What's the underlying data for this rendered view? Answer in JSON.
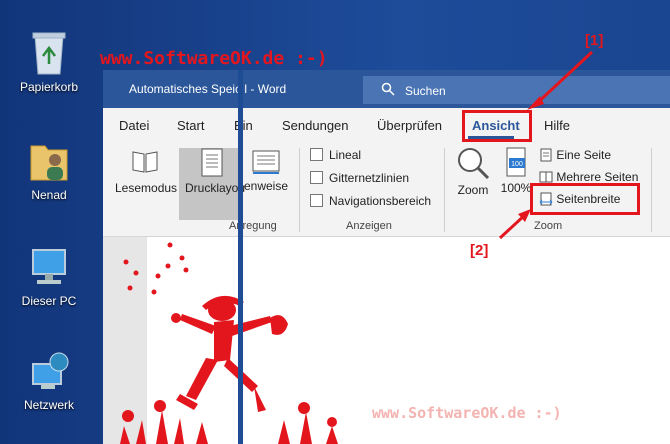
{
  "desktop": {
    "icons": [
      {
        "label": "Papierkorb",
        "icon": "recycle-bin-icon"
      },
      {
        "label": "Nenad",
        "icon": "user-folder-icon"
      },
      {
        "label": "Dieser PC",
        "icon": "computer-icon"
      },
      {
        "label": "Netzwerk",
        "icon": "network-icon"
      }
    ]
  },
  "watermark_top": "www.SoftwareOK.de :-)",
  "watermark_bottom": "www.SoftwareOK.de :-)",
  "annotations": {
    "tab_marker": "[1]",
    "button_marker": "[2]"
  },
  "word": {
    "title": "Automatisches Speic l  -  Word",
    "search_placeholder": "Suchen",
    "tabs": [
      "Datei",
      "Start",
      "Ein",
      "Sendungen",
      "Überprüfen",
      "Ansicht",
      "Hilfe"
    ],
    "active_tab": "Ansicht",
    "ribbon": {
      "views": {
        "lesemodus": "Lesemodus",
        "drucklayout": "Drucklayou",
        "web": "enweise"
      },
      "groups": {
        "anregung": "Anregung",
        "anzeigen": "Anzeigen",
        "zoom": "Zoom"
      },
      "anzeigen_items": [
        "Lineal",
        "Gitternetzlinien",
        "Navigationsbereich"
      ],
      "zoom_label": "Zoom",
      "zoom_100": "100%",
      "zoom_100_badge": "100",
      "eine_seite": "Eine Seite",
      "mehrere_seiten": "Mehrere Seiten",
      "seitenbreite": "Seitenbreite"
    }
  },
  "colors": {
    "word_blue": "#2b579a",
    "annotation_red": "#e3161e"
  }
}
